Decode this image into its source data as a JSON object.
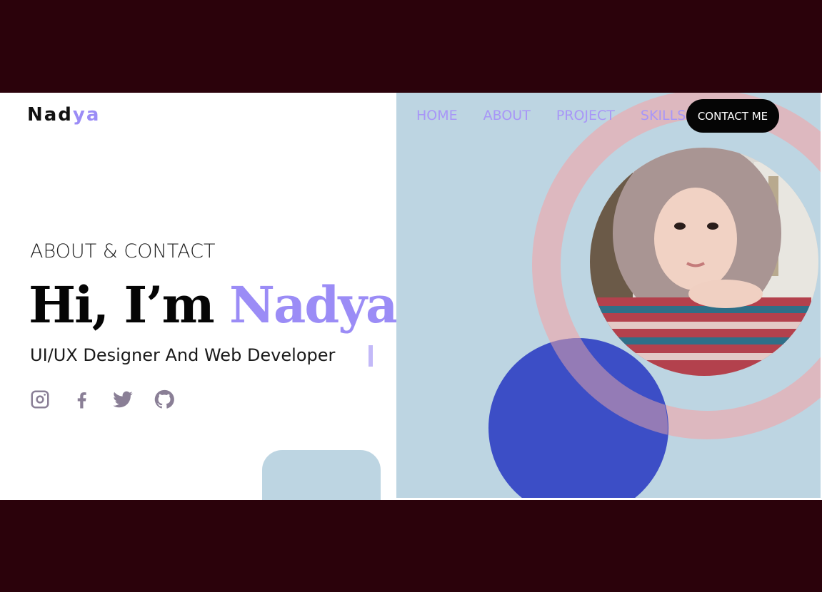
{
  "logo": {
    "main": "Nad",
    "accent": "ya"
  },
  "nav": {
    "links": [
      "HOME",
      "ABOUT",
      "PROJECT",
      "SKILLS"
    ],
    "contact_label": "CONTACT ME"
  },
  "hero": {
    "eyebrow": "ABOUT & CONTACT",
    "headline_prefix": "Hi, I’m",
    "headline_name": "Nadya",
    "subtitle": "UI/UX Designer And Web Developer"
  },
  "socials": [
    "instagram-icon",
    "facebook-icon",
    "twitter-icon",
    "github-icon"
  ],
  "colors": {
    "accent": "#9b8cf6",
    "panel": "#bdd5e2",
    "ring": "#ddb8bf",
    "blue": "#3c4ec6",
    "frame": "#2b020b"
  }
}
